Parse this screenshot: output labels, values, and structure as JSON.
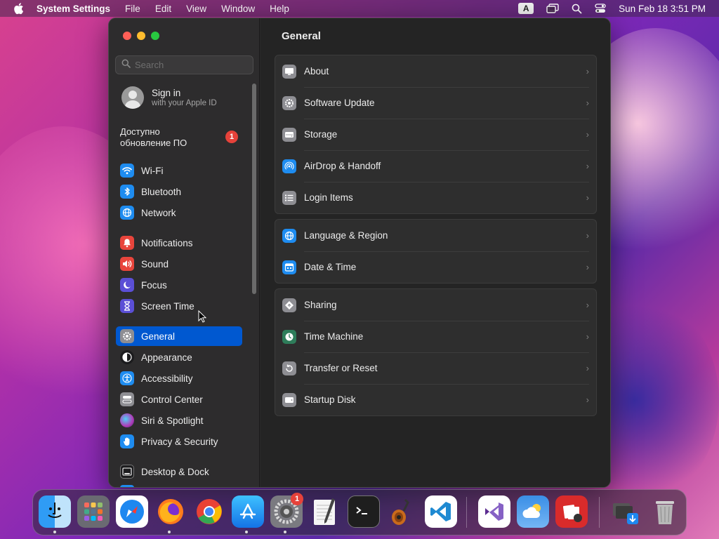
{
  "menubar": {
    "app_name": "System Settings",
    "items": [
      "File",
      "Edit",
      "View",
      "Window",
      "Help"
    ],
    "input_indicator": "A",
    "datetime": "Sun Feb 18  3:51 PM"
  },
  "search": {
    "placeholder": "Search"
  },
  "account": {
    "title": "Sign in",
    "subtitle": "with your Apple ID"
  },
  "update_notice": {
    "line1": "Доступно",
    "line2": "обновление ПО",
    "badge": "1"
  },
  "sidebar": {
    "items": [
      {
        "label": "Wi-Fi",
        "icon": "wifi-icon",
        "color": "#1e8cf0"
      },
      {
        "label": "Bluetooth",
        "icon": "bluetooth-icon",
        "color": "#1e8cf0"
      },
      {
        "label": "Network",
        "icon": "globe-icon",
        "color": "#1e8cf0"
      },
      {
        "label": "Notifications",
        "icon": "bell-icon",
        "color": "#e8453c"
      },
      {
        "label": "Sound",
        "icon": "speaker-icon",
        "color": "#e8453c"
      },
      {
        "label": "Focus",
        "icon": "moon-icon",
        "color": "#5b4fd6"
      },
      {
        "label": "Screen Time",
        "icon": "hourglass-icon",
        "color": "#5b4fd6"
      },
      {
        "label": "General",
        "icon": "gear-icon",
        "color": "#8e8e93"
      },
      {
        "label": "Appearance",
        "icon": "appearance-icon",
        "color": "#1c1c1e"
      },
      {
        "label": "Accessibility",
        "icon": "accessibility-icon",
        "color": "#1e8cf0"
      },
      {
        "label": "Control Center",
        "icon": "control-center-icon",
        "color": "#8e8e93"
      },
      {
        "label": "Siri & Spotlight",
        "icon": "siri-icon",
        "color": "#b03ab8"
      },
      {
        "label": "Privacy & Security",
        "icon": "hand-icon",
        "color": "#1e8cf0"
      },
      {
        "label": "Desktop & Dock",
        "icon": "dock-icon",
        "color": "#1c1c1e"
      }
    ],
    "selected": "General"
  },
  "content": {
    "title": "General",
    "groups": [
      [
        {
          "label": "About",
          "icon": "monitor-icon"
        },
        {
          "label": "Software Update",
          "icon": "gear-update-icon"
        },
        {
          "label": "Storage",
          "icon": "drive-icon"
        },
        {
          "label": "AirDrop & Handoff",
          "icon": "airdrop-icon"
        },
        {
          "label": "Login Items",
          "icon": "list-icon"
        }
      ],
      [
        {
          "label": "Language & Region",
          "icon": "globe-icon"
        },
        {
          "label": "Date & Time",
          "icon": "calendar-icon"
        }
      ],
      [
        {
          "label": "Sharing",
          "icon": "sharing-icon"
        },
        {
          "label": "Time Machine",
          "icon": "time-machine-icon"
        },
        {
          "label": "Transfer or Reset",
          "icon": "reset-icon"
        },
        {
          "label": "Startup Disk",
          "icon": "disk-icon"
        }
      ]
    ]
  },
  "dock": {
    "apps": [
      {
        "name": "finder",
        "running": true
      },
      {
        "name": "launchpad",
        "running": false
      },
      {
        "name": "safari",
        "running": false
      },
      {
        "name": "firefox",
        "running": true
      },
      {
        "name": "chrome",
        "running": false
      },
      {
        "name": "app-store",
        "running": true
      },
      {
        "name": "system-settings",
        "running": true,
        "badge": "1"
      },
      {
        "name": "textedit",
        "running": false
      },
      {
        "name": "terminal",
        "running": false
      },
      {
        "name": "garageband",
        "running": false
      },
      {
        "name": "vscode",
        "running": false
      },
      {
        "name": "visual-studio",
        "running": false
      },
      {
        "name": "weather",
        "running": false
      },
      {
        "name": "photo-booth",
        "running": false
      },
      {
        "name": "downloads-stack",
        "running": false
      },
      {
        "name": "trash",
        "running": false
      }
    ]
  }
}
